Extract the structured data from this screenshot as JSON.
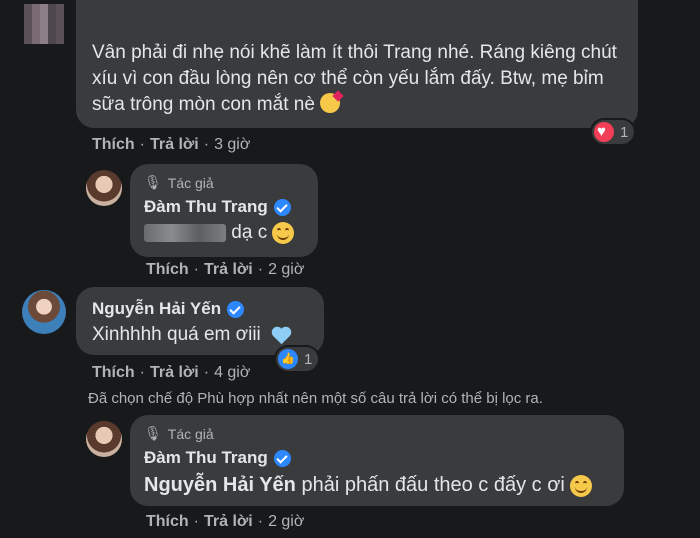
{
  "comment1": {
    "text": "Vân phải đi nhẹ nói khẽ làm ít thôi Trang nhé. Ráng kiêng chút xíu vì con đầu lòng nên cơ thể còn yếu lắm đấy. Btw, mẹ bỉm sữa trông mòn con mắt nè",
    "reaction_count": "1",
    "actions": {
      "like": "Thích",
      "reply": "Trả lời",
      "time": "3 giờ"
    }
  },
  "reply1": {
    "author_tag": "Tác giả",
    "author": "Đàm Thu Trang",
    "text": "dạ c",
    "actions": {
      "like": "Thích",
      "reply": "Trả lời",
      "time": "2 giờ"
    }
  },
  "comment2": {
    "author": "Nguyễn Hải Yến",
    "text": "Xinhhhh quá em ơiii",
    "reaction_count": "1",
    "actions": {
      "like": "Thích",
      "reply": "Trả lời",
      "time": "4 giờ"
    }
  },
  "filter_notice": "Đã chọn chế độ Phù hợp nhất nên một số câu trả lời có thể bị lọc ra.",
  "reply2": {
    "author_tag": "Tác giả",
    "author": "Đàm Thu Trang",
    "mention": "Nguyễn Hải Yến",
    "text": "phải phấn đấu theo c đấy c ơi",
    "actions": {
      "like": "Thích",
      "reply": "Trả lời",
      "time": "2 giờ"
    }
  },
  "colors": {
    "background": "#18191a",
    "bubble": "#3a3b3c",
    "verified": "#2d88ff",
    "secondary_text": "#b0b3b8"
  }
}
